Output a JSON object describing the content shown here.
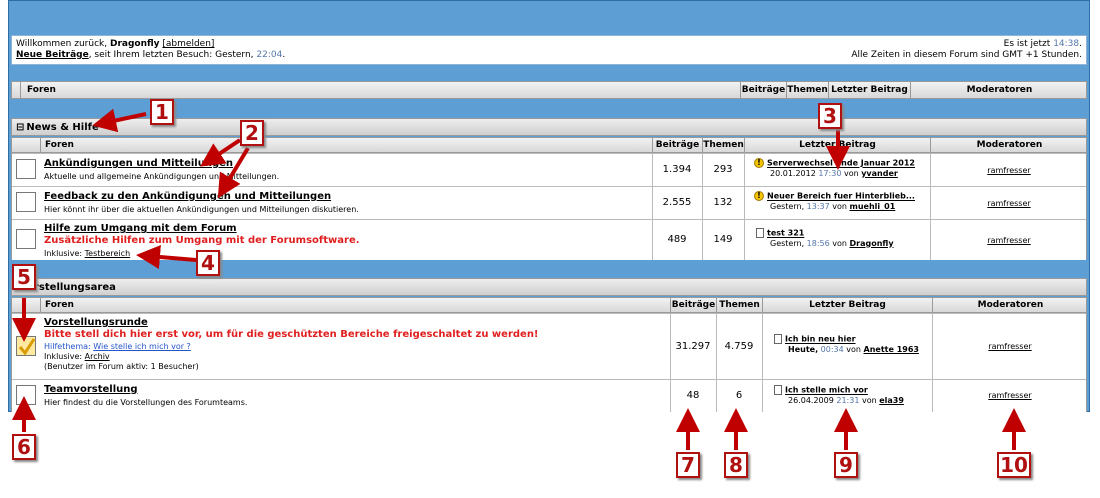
{
  "welcome": {
    "line1_prefix": "Willkommen zurück,",
    "user": "Dragonfly",
    "logout": "[abmelden]",
    "new_posts": "Neue Beiträge",
    "last_visit_prefix": ", seit Ihrem letzten Besuch: Gestern,",
    "last_visit_time": "22:04",
    "last_visit_suffix": ".",
    "now_prefix": "Es ist jetzt",
    "now_time": "14:38",
    "now_suffix": ".",
    "timezone": "Alle Zeiten in diesem Forum sind GMT +1 Stunden."
  },
  "header": {
    "foren": "Foren",
    "beitraege": "Beiträge",
    "themen": "Themen",
    "letzter_beitrag": "Letzter Beitrag",
    "moderatoren": "Moderatoren"
  },
  "cat1": {
    "toggle": "⊟",
    "name": "News & Hilfe",
    "rows": [
      {
        "title": "Ankündigungen und Mitteilungen",
        "desc": "Aktuelle und allgemeine Ankündigungen und Mitteilungen.",
        "posts": "1.394",
        "topics": "293",
        "last_title": "Serverwechsel Ende Januar 2012",
        "last_date": "20.01.2012",
        "last_time": "17:30",
        "last_by": "von",
        "last_user": "yvander",
        "mod": "ramfresser"
      },
      {
        "title": "Feedback zu den Ankündigungen und Mitteilungen",
        "desc": "Hier könnt ihr über die aktuellen Ankündigungen und Mitteilungen diskutieren.",
        "posts": "2.555",
        "topics": "132",
        "last_title": "Neuer Bereich fuer Hinterblieb...",
        "last_date": "Gestern,",
        "last_time": "13:37",
        "last_by": "von",
        "last_user": "muehli_01",
        "mod": "ramfresser"
      },
      {
        "title": "Hilfe zum Umgang mit dem Forum",
        "red": "Zusätzliche Hilfen zum Umgang mit der Forumsoftware.",
        "incl_prefix": "Inklusive:",
        "incl_link": "Testbereich",
        "posts": "489",
        "topics": "149",
        "last_title": "test 321",
        "last_date": "Gestern,",
        "last_time": "18:56",
        "last_by": "von",
        "last_user": "Dragonfly",
        "mod": "ramfresser"
      }
    ]
  },
  "cat2": {
    "name": "rstellungsarea",
    "rows": [
      {
        "title": "Vorstellungsrunde",
        "red": "Bitte stell dich hier erst vor, um für die geschützten Bereiche freigeschaltet zu werden!",
        "helptheme_prefix": "Hilfethema:",
        "helptheme_link": "Wie stelle ich mich vor ?",
        "incl_prefix": "Inklusive:",
        "incl_link": "Archiv",
        "active": "(Benutzer im Forum aktiv: 1 Besucher)",
        "posts": "31.297",
        "topics": "4.759",
        "last_title": "Ich bin neu hier",
        "last_date": "Heute,",
        "last_time": "00:34",
        "last_by": "von",
        "last_user": "Anette 1963",
        "mod": "ramfresser"
      },
      {
        "title": "Teamvorstellung",
        "desc": "Hier findest du die Vorstellungen des Forumteams.",
        "posts": "48",
        "topics": "6",
        "last_title": "Ich stelle mich vor",
        "last_date": "26.04.2009",
        "last_time": "21:31",
        "last_by": "von",
        "last_user": "ela39",
        "mod": "ramfresser"
      }
    ]
  },
  "badges": [
    "1",
    "2",
    "3",
    "4",
    "5",
    "6",
    "7",
    "8",
    "9",
    "10"
  ],
  "colors": {
    "frame": "#5d9ed4",
    "annotation": "#c00000",
    "red_text": "#e02020",
    "time": "#5577aa"
  }
}
